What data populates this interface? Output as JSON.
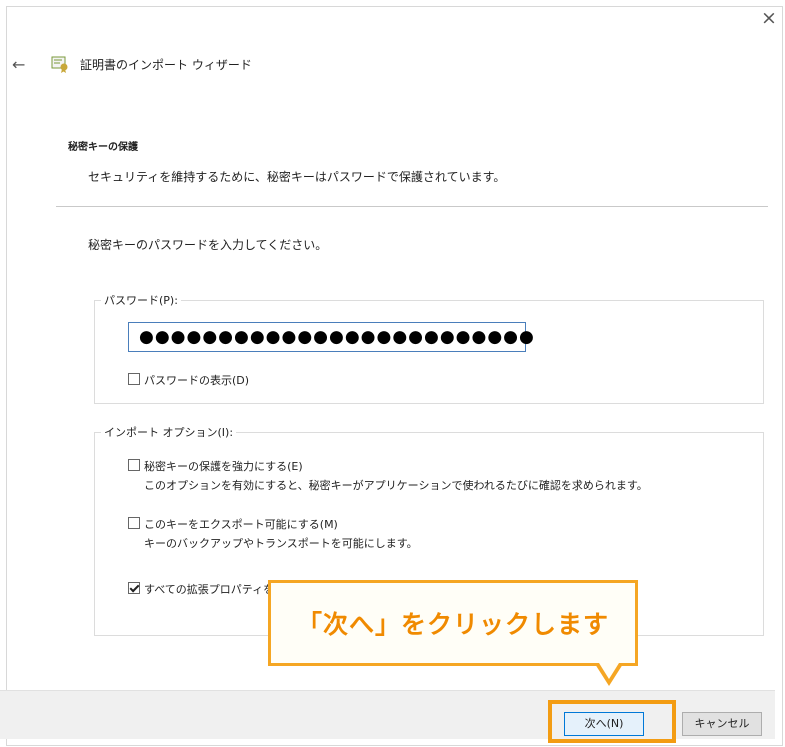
{
  "window": {
    "close_label": "×",
    "wizard_title": "証明書のインポート ウィザード"
  },
  "header": {
    "heading": "秘密キーの保護",
    "description": "セキュリティを維持するために、秘密キーはパスワードで保護されています。"
  },
  "main": {
    "instruction": "秘密キーのパスワードを入力してください。",
    "password_group_label": "パスワード(P):",
    "password_value": "●●●●●●●●●●●●●●●●●●●●●●●●●",
    "show_password_label": "パスワードの表示(D)",
    "options_group_label": "インポート オプション(I):",
    "options": [
      {
        "label": "秘密キーの保護を強力にする(E)",
        "sub": "このオプションを有効にすると、秘密キーがアプリケーションで使われるたびに確認を求められます。",
        "checked": false
      },
      {
        "label": "このキーをエクスポート可能にする(M)",
        "sub": "キーのバックアップやトランスポートを可能にします。",
        "checked": false
      },
      {
        "label": "すべての拡張プロパティを含める(A)",
        "checked": true
      }
    ]
  },
  "footer": {
    "next_label": "次へ(N)",
    "cancel_label": "キャンセル"
  },
  "annotation": {
    "callout_text": "「次へ」をクリックします"
  },
  "colors": {
    "accent": "#f5a623",
    "callout_text": "#f08a00"
  }
}
